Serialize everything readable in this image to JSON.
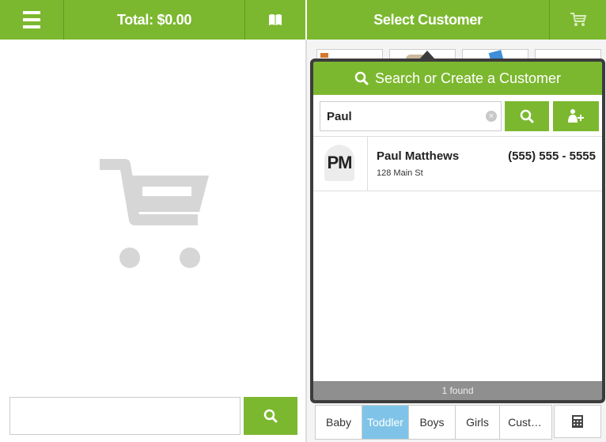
{
  "header": {
    "menu_icon": "hamburger-icon",
    "total_label": "Total: $0.00",
    "book_icon": "book-icon",
    "select_customer_label": "Select Customer",
    "cart_icon": "cart-icon"
  },
  "colors": {
    "brand_green": "#7cb82f",
    "active_tab": "#7fc4e8",
    "overlay_dark": "#3c3c3c"
  },
  "left": {
    "empty_cart_icon": "shopping-cart-icon",
    "barcode_input_value": "",
    "search_icon": "search-icon"
  },
  "popup": {
    "title": "Search or Create a Customer",
    "search_value": "Paul",
    "clear_icon": "clear-icon",
    "search_button_icon": "search-icon",
    "add_customer_icon": "add-customer-icon",
    "results": [
      {
        "initials": "PM",
        "name": "Paul Matthews",
        "address": "128 Main St",
        "phone": "(555) 555 - 5555"
      }
    ],
    "found_text": "1 found"
  },
  "categories": {
    "tabs": [
      {
        "label": "Baby",
        "active": false
      },
      {
        "label": "Toddler",
        "active": true
      },
      {
        "label": "Boys",
        "active": false
      },
      {
        "label": "Girls",
        "active": false
      },
      {
        "label": "Cust…",
        "active": false
      }
    ],
    "calculator_icon": "calculator-icon"
  }
}
